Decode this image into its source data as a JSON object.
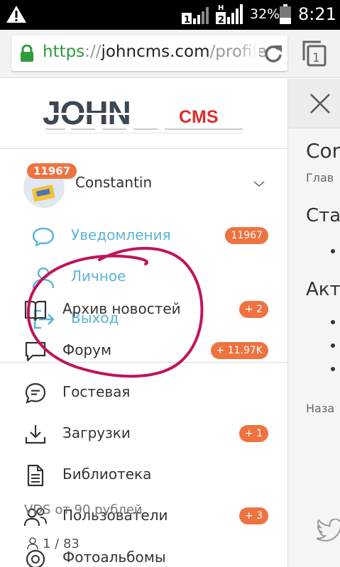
{
  "status_bar": {
    "sim1": "1",
    "sim2": "2",
    "sim2_network": "H",
    "battery": "32%",
    "clock": "8:21",
    "icons": [
      "warning-icon",
      "signal-icon",
      "battery-icon"
    ]
  },
  "browser": {
    "url_scheme": "https",
    "url_sep": "://",
    "url_host": "johncms.com",
    "url_path": "/profile",
    "tab_count": "1",
    "colors": {
      "secure": "#2e9b3c"
    }
  },
  "logo": {
    "main": "JOHN",
    "suffix": "CMS"
  },
  "user": {
    "name": "Constantin",
    "badge": "11967"
  },
  "user_menu": [
    {
      "label": "Уведомления",
      "badge": "11967",
      "icon": "chat-bubble-icon"
    },
    {
      "label": "Личное",
      "icon": "user-icon"
    },
    {
      "label": "Выход",
      "icon": "logout-icon"
    }
  ],
  "menu": [
    {
      "label": "Архив новостей",
      "badge": "+ 2",
      "icon": "book-icon"
    },
    {
      "label": "Форум",
      "badge": "+ 11.97K",
      "icon": "forum-icon"
    },
    {
      "label": "Гостевая",
      "icon": "guestbook-icon"
    },
    {
      "label": "Загрузки",
      "badge": "+ 1",
      "icon": "download-icon"
    },
    {
      "label": "Библиотека",
      "icon": "document-icon"
    },
    {
      "label": "Пользователи",
      "badge": "+ 3",
      "icon": "users-icon"
    },
    {
      "label": "Фотоальбомы",
      "icon": "camera-icon"
    }
  ],
  "footer": {
    "ad": "VDS от 90 рублей",
    "online": "1 / 83"
  },
  "background_page": {
    "title": "Con",
    "breadcrumb": "Глав",
    "heading_1": "Стат",
    "heading_2": "Акти",
    "back": "Наза"
  },
  "colors": {
    "accent": "#ee7340",
    "link": "#5ab4d7",
    "scribble": "#c0145a"
  }
}
